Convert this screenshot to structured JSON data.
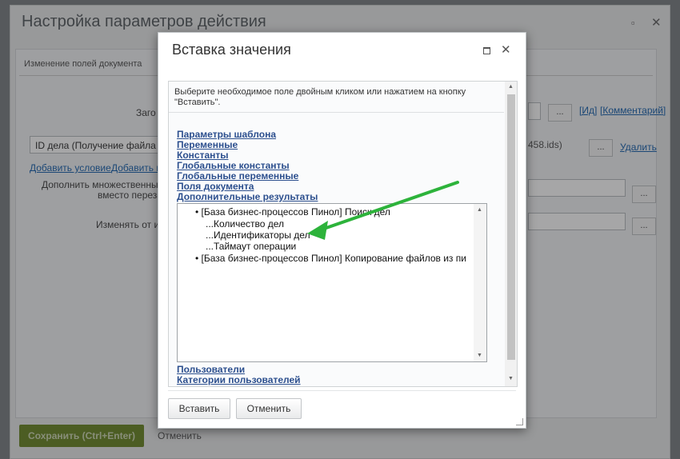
{
  "background": {
    "title": "Настройка параметров действия",
    "section_label": "Изменение полей документа",
    "label_zag": "Заго",
    "link_id": "[Ид]",
    "link_comment": "[Комментарий]",
    "id_field_value": "ID дела (Получение файла",
    "id_field_suffix": "458.ids)",
    "dots": "...",
    "delete_link": "Удалить",
    "add_condition": "Добавить условие",
    "add_p": "Добавить п",
    "multi_line1": "Дополнить множественные",
    "multi_line2": "вместо переза",
    "change_from": "Изменять от и",
    "save_button": "Сохранить (Ctrl+Enter)",
    "cancel_button": "Отменить"
  },
  "modal": {
    "title": "Вставка значения",
    "instruction": "Выберите необходимое поле двойным кликом или нажатием на кнопку \"Вставить\".",
    "links_top": [
      "Параметры шаблона",
      "Переменные",
      "Константы",
      "Глобальные константы",
      "Глобальные переменные",
      "Поля документа",
      "Дополнительные результаты"
    ],
    "tree": {
      "group1": "• [База бизнес-процессов Пинол] Поиск дел",
      "children": [
        "...Количество дел",
        "...Идентификаторы дел",
        "...Таймаут операции"
      ],
      "group2": "• [База бизнес-процессов Пинол] Копирование файлов из пи"
    },
    "links_bottom": [
      "Пользователи",
      "Категории пользователей"
    ],
    "insert_button": "Вставить",
    "cancel_button": "Отменить"
  },
  "colors": {
    "annotation_arrow": "#2db33b",
    "link": "#2c4f8e",
    "save_green": "#6e8a2a"
  }
}
